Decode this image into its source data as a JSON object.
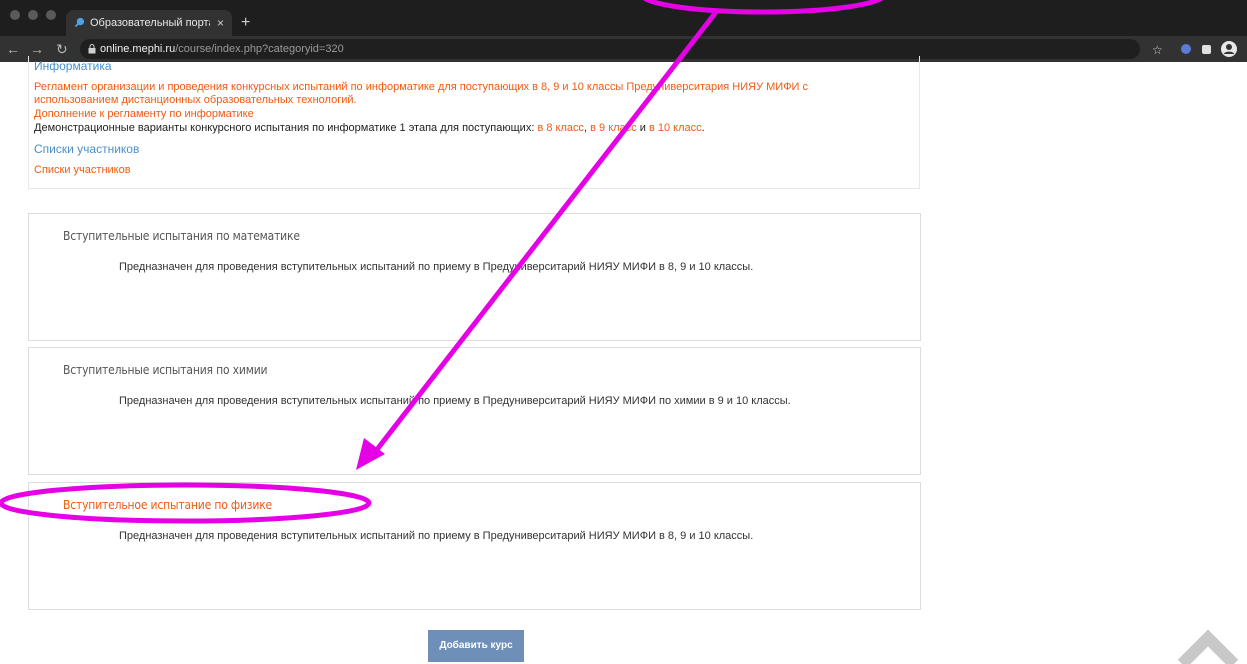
{
  "browser": {
    "tab_title": "Образовательный портал НИ",
    "tab_close": "×",
    "new_tab": "+",
    "url_host": "online.mephi.ru",
    "url_path": "/course/index.php?categoryid=320"
  },
  "info_section": {
    "heading": "Информатика",
    "reglament": "Регламент организации и проведения конкурсных испытаний по информатике для поступающих в 8, 9 и 10 классы Предуниверситария НИЯУ МИФИ с",
    "reglament_line2": "использованием дистанционных образовательных технологий.",
    "supplement": "Дополнение к регламенту по информатике",
    "demo_prefix": "Демонстрационные варианты конкурсного испытания по информатике 1 этапа для поступающих:",
    "demo_link8": "в 8 класс",
    "demo_comma": ",",
    "demo_link9": "в 9 класс",
    "demo_and": "и",
    "demo_link10": "в 10 класс",
    "demo_dot": ".",
    "participants_heading": "Списки участников",
    "participants_link": "Списки участников"
  },
  "courses": [
    {
      "title": "Вступительные испытания по математике",
      "desc": "Предназначен для проведения вступительных испытаний по приему в Предуниверситарий НИЯУ МИФИ в 8, 9 и 10 классы."
    },
    {
      "title": "Вступительные испытания по химии",
      "desc": "Предназначен для проведения вступительных испытаний по приему в Предуниверситарий НИЯУ МИФИ по химии в 9 и 10 классы."
    },
    {
      "title": "Вступительное испытание по физике",
      "desc": "Предназначен для проведения вступительных испытаний по приему в Предуниверситарий НИЯУ МИФИ в 8, 9 и 10 классы."
    }
  ],
  "add_course_label": "Добавить курс",
  "colors": {
    "accent_orange": "#f05a14",
    "link_blue": "#4a90c8",
    "annotation_magenta": "#e600e6",
    "button_blue": "#6d8fb8"
  }
}
